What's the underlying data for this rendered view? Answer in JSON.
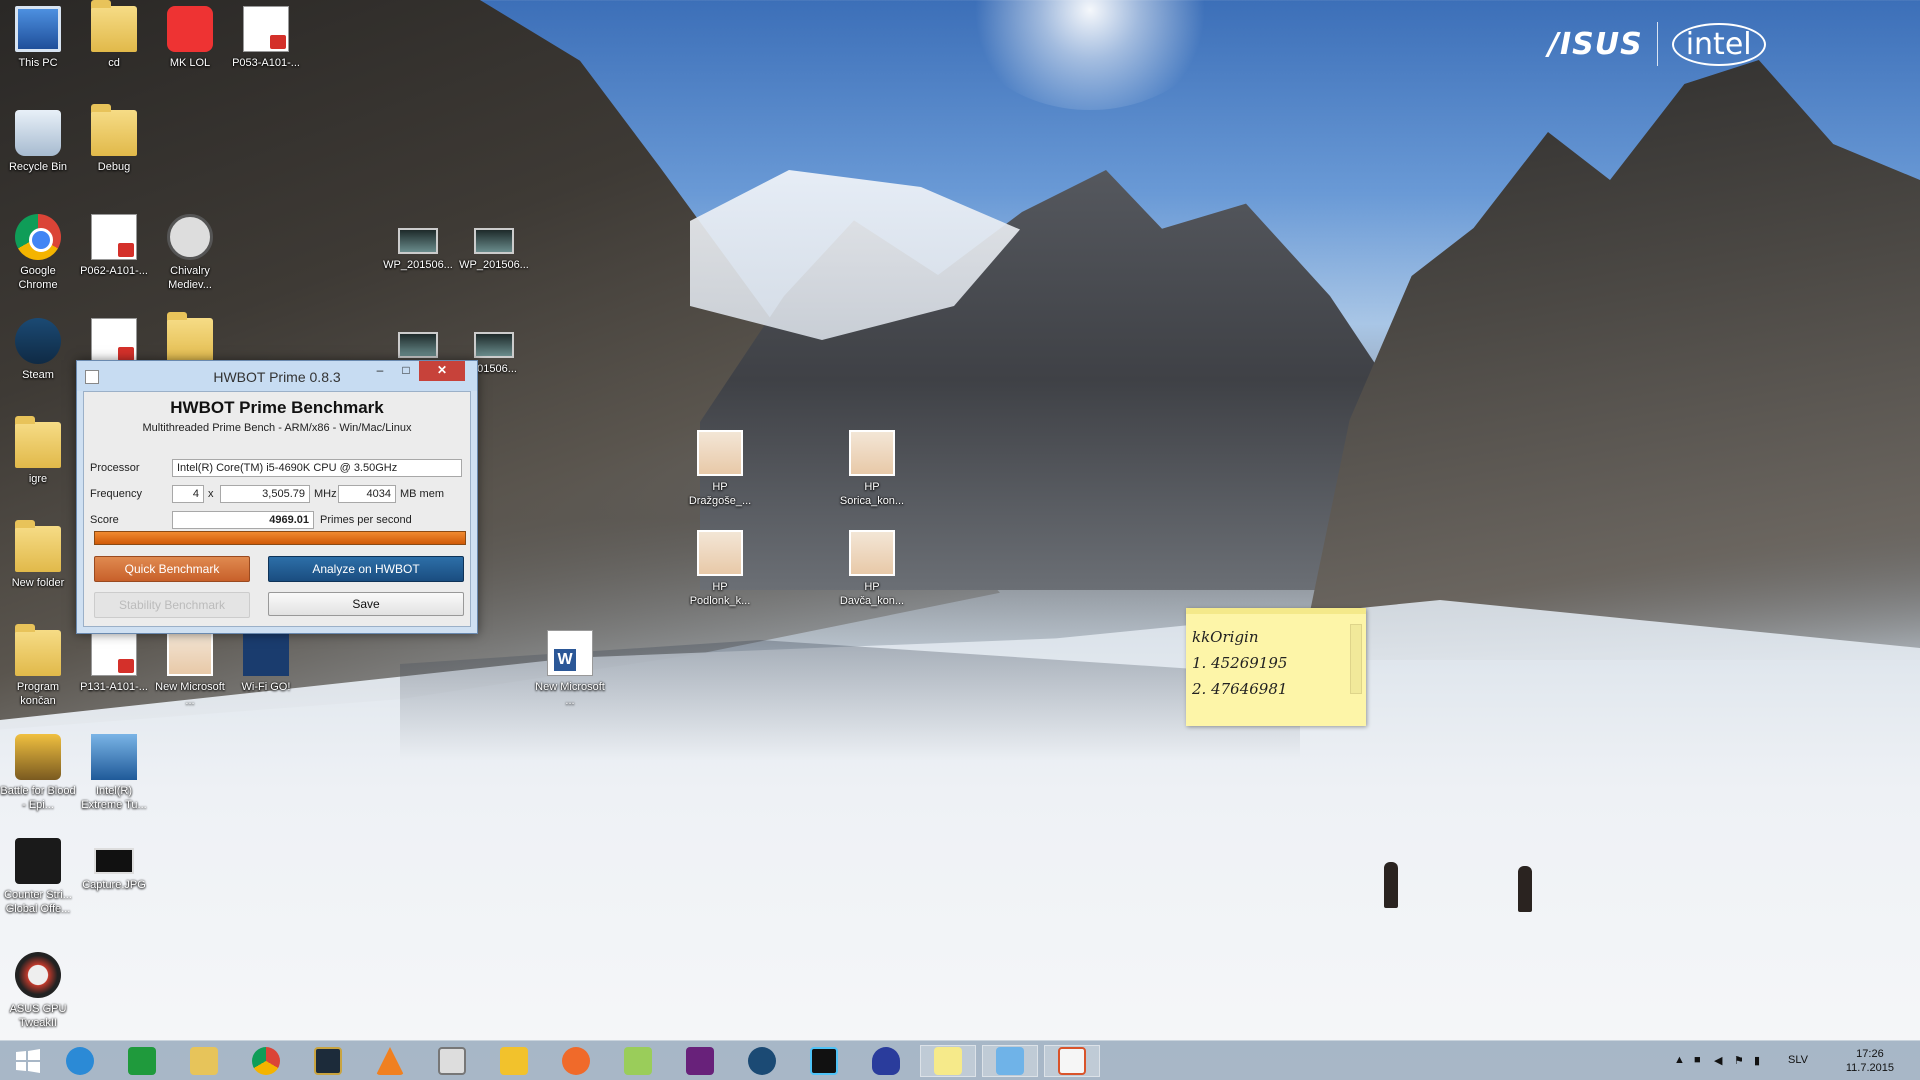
{
  "brand": {
    "asus": "/ISUS",
    "intel": "intel"
  },
  "desktop_icons": [
    {
      "label": "This PC"
    },
    {
      "label": "cd"
    },
    {
      "label": "MK LOL"
    },
    {
      "label": "P053-A101-..."
    },
    {
      "label": "Recycle Bin"
    },
    {
      "label": "Debug"
    },
    {
      "label": "Google Chrome"
    },
    {
      "label": "P062-A101-..."
    },
    {
      "label": "Chivalry Mediev..."
    },
    {
      "label": "WP_201506..."
    },
    {
      "label": "WP_201506..."
    },
    {
      "label": "Steam"
    },
    {
      "label": "201506..."
    },
    {
      "label": "igre"
    },
    {
      "label": "HP Dražgoše_..."
    },
    {
      "label": "HP Sorica_kon..."
    },
    {
      "label": "New folder"
    },
    {
      "label": "HP Podlonk_k..."
    },
    {
      "label": "HP Davča_kon..."
    },
    {
      "label": "Program končan"
    },
    {
      "label": "P131-A101-..."
    },
    {
      "label": "New Microsoft ..."
    },
    {
      "label": "Wi-Fi GO!"
    },
    {
      "label": "New Microsoft ..."
    },
    {
      "label": "Battle for Blood - Epi..."
    },
    {
      "label": "Intel(R) Extreme Tu..."
    },
    {
      "label": "Counter Stri... Global Offe..."
    },
    {
      "label": "Capture.JPG"
    },
    {
      "label": "ASUS GPU TweakII"
    }
  ],
  "hwbot": {
    "window_title": "HWBOT Prime 0.8.3",
    "minimize": "–",
    "maximize": "□",
    "close": "✕",
    "heading": "HWBOT Prime Benchmark",
    "subheading": "Multithreaded Prime Bench - ARM/x86 - Win/Mac/Linux",
    "processor_label": "Processor",
    "processor_value": "Intel(R) Core(TM) i5-4690K CPU @ 3.50GHz",
    "frequency_label": "Frequency",
    "cores_value": "4",
    "times": "x",
    "mhz_value": "3,505.79",
    "mhz_unit": "MHz",
    "mem_value": "4034",
    "mem_unit": "MB mem",
    "score_label": "Score",
    "score_value": "4969.01",
    "score_unit": "Primes per second",
    "progress": 1.0,
    "quick_benchmark": "Quick Benchmark",
    "analyze": "Analyze on HWBOT",
    "stability": "Stability Benchmark",
    "save": "Save"
  },
  "sticky_note": {
    "line1": "kkOrigin",
    "line2": "1. 45269195",
    "line3": "2. 47646981"
  },
  "taskbar": {
    "apps": [
      "start-icon",
      "ie-icon",
      "store-icon",
      "explorer-icon",
      "chrome-icon",
      "lol-icon",
      "vlc-icon",
      "monitor-icon",
      "snipping-icon",
      "origin-icon",
      "tool-icon",
      "visual-studio-icon",
      "steam-icon",
      "game-icon",
      "hand-icon",
      "sticky-notes-icon",
      "intel-icon",
      "java-icon"
    ],
    "language": "SLV",
    "time": "17:26",
    "date": "11.7.2015"
  }
}
